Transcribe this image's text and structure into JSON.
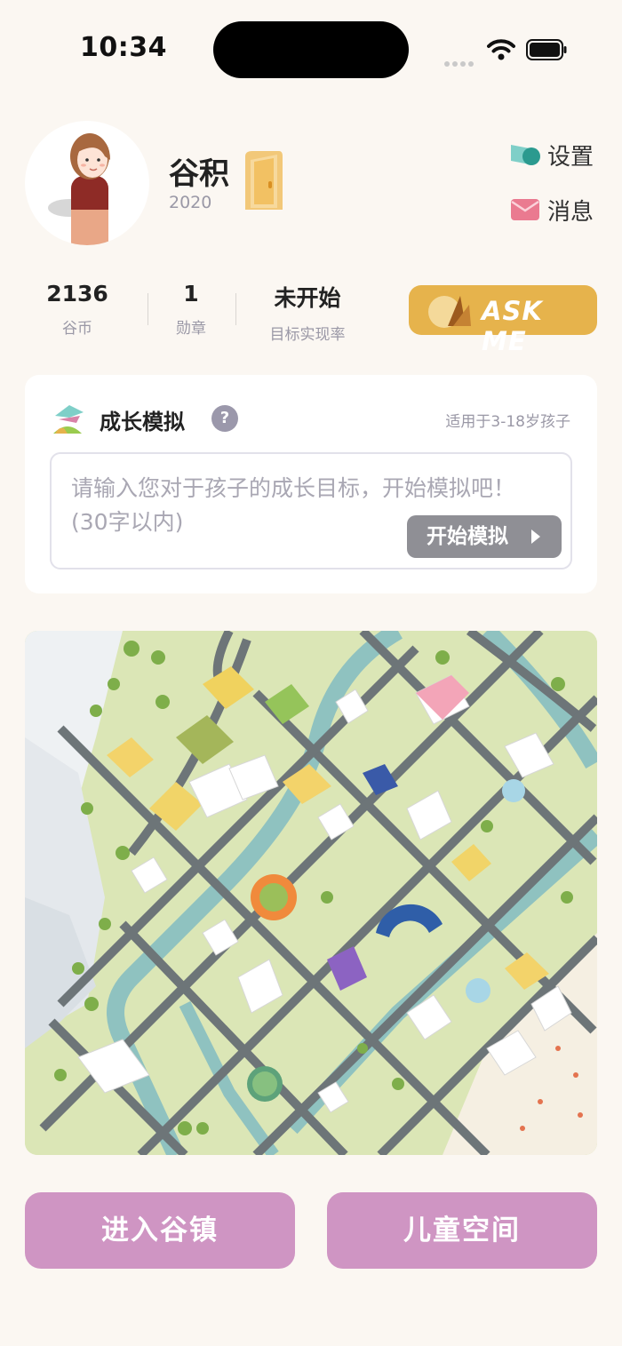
{
  "status_bar": {
    "time": "10:34"
  },
  "profile": {
    "name": "谷积",
    "year": "2020"
  },
  "header_links": {
    "settings": "设置",
    "messages": "消息"
  },
  "stats": [
    {
      "value": "2136",
      "label": "谷币"
    },
    {
      "value": "1",
      "label": "勋章"
    },
    {
      "value": "未开始",
      "label": "目标实现率"
    }
  ],
  "ask_button": {
    "label": "ASK ME"
  },
  "simulation": {
    "title": "成长模拟",
    "help": "?",
    "hint": "适用于3-18岁孩子",
    "placeholder": "请输入您对于孩子的成长目标，开始模拟吧！(30字以内)",
    "start_button": "开始模拟"
  },
  "bottom_buttons": {
    "enter_town": "进入谷镇",
    "children_space": "儿童空间"
  },
  "colors": {
    "background": "#fbf7f2",
    "accent_gold": "#e6b34c",
    "button_pink": "#cf95c3",
    "start_button_gray": "#8f8f95",
    "help_icon_gray": "#9b98ab"
  }
}
